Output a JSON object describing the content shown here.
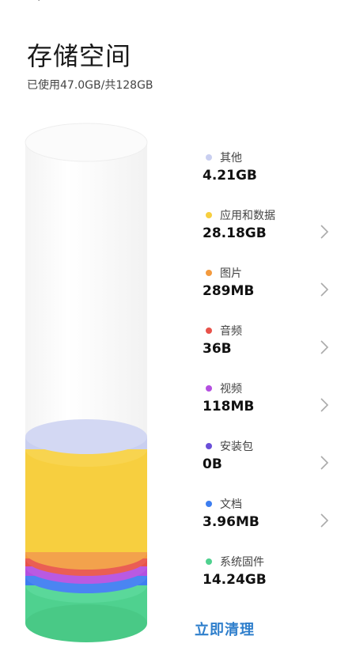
{
  "header": {
    "title": "存储空间",
    "usage": "已使用47.0GB/共128GB"
  },
  "categories": [
    {
      "label": "其他",
      "value": "4.21GB",
      "color": "#c9cff0",
      "chevron": false
    },
    {
      "label": "应用和数据",
      "value": "28.18GB",
      "color": "#f7cf3f",
      "chevron": true
    },
    {
      "label": "图片",
      "value": "289MB",
      "color": "#f39a3e",
      "chevron": true
    },
    {
      "label": "音频",
      "value": "36B",
      "color": "#e8524a",
      "chevron": true
    },
    {
      "label": "视频",
      "value": "118MB",
      "color": "#b44fe0",
      "chevron": true
    },
    {
      "label": "安装包",
      "value": "0B",
      "color": "#6a4fd8",
      "chevron": true
    },
    {
      "label": "文档",
      "value": "3.96MB",
      "color": "#3d7ef0",
      "chevron": true
    },
    {
      "label": "系统固件",
      "value": "14.24GB",
      "color": "#4fd18f",
      "chevron": false
    }
  ],
  "actions": {
    "clean_label": "立即清理"
  }
}
